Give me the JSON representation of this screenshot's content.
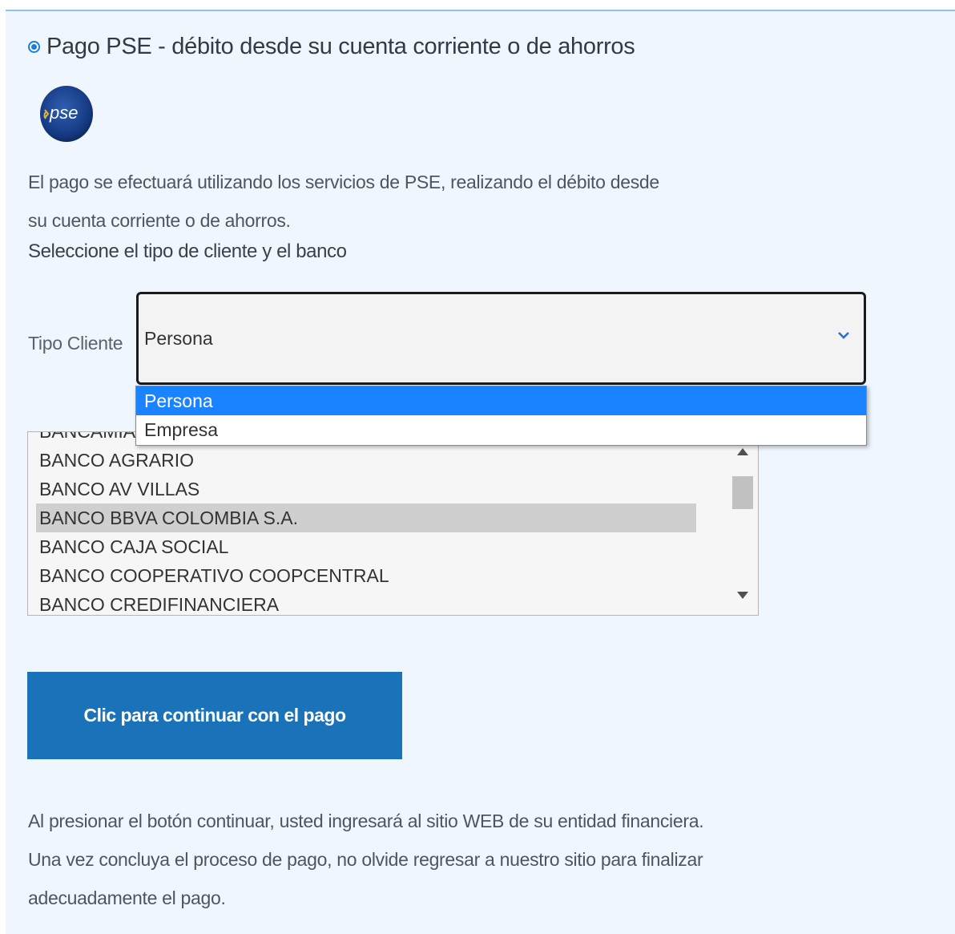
{
  "payment_method": {
    "title": "Pago PSE - débito desde su cuenta corriente o de ahorros",
    "selected": true,
    "logo_text": "pse"
  },
  "description": {
    "line1": "El pago se efectuará utilizando los servicios de PSE, realizando el débito desde",
    "line2": "su cuenta corriente o de ahorros."
  },
  "select_heading": "Seleccione el tipo de cliente y el banco",
  "tipo_cliente": {
    "label": "Tipo Cliente",
    "value": "Persona",
    "options": [
      "Persona",
      "Empresa"
    ],
    "highlighted_option": "Persona"
  },
  "banks": {
    "items": [
      "BANCAMIA",
      "BANCO AGRARIO",
      "BANCO AV VILLAS",
      "BANCO BBVA COLOMBIA S.A.",
      "BANCO CAJA SOCIAL",
      "BANCO COOPERATIVO COOPCENTRAL",
      "BANCO CREDIFINANCIERA"
    ],
    "highlighted": "BANCO BBVA COLOMBIA S.A."
  },
  "continue_button": "Clic para continuar con el pago",
  "footer_note": {
    "line1": "Al presionar el botón continuar, usted ingresará al sitio WEB de su entidad financiera.",
    "line2": "Una vez concluya el proceso de pago, no olvide regresar a nuestro sitio para finalizar",
    "line3": "adecuadamente el pago."
  },
  "colors": {
    "panel_bg": "#eff6fd",
    "button_bg": "#1a72b9",
    "option_selected": "#1a83ff",
    "radio": "#1a7de0"
  }
}
